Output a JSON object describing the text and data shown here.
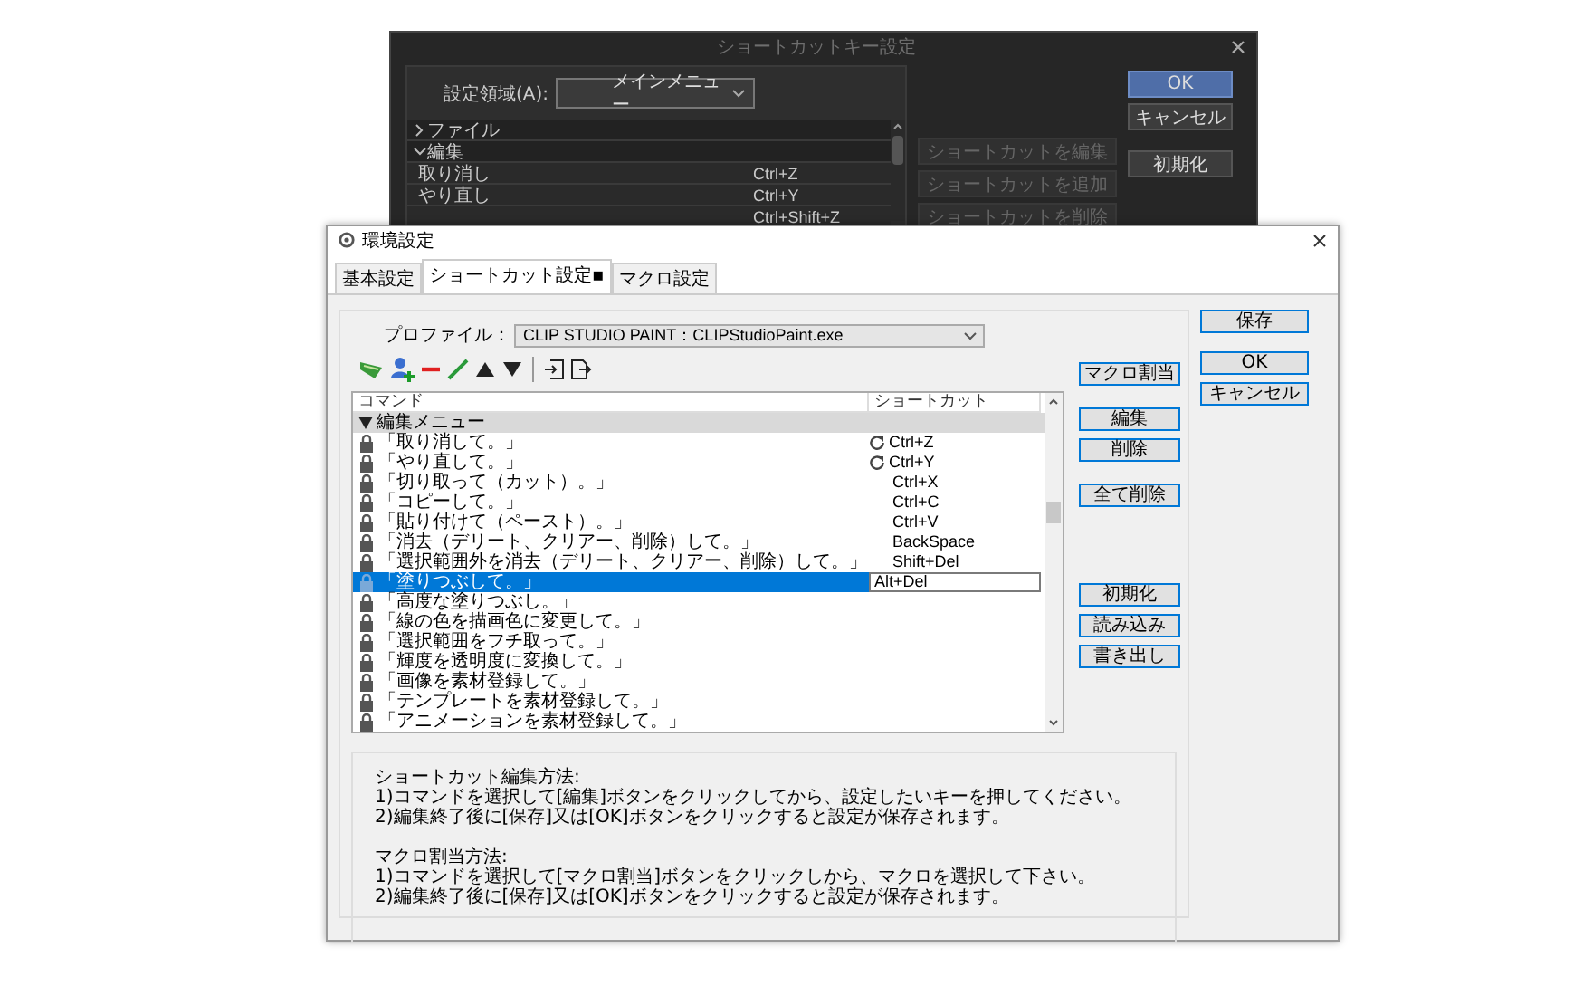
{
  "back_dialog": {
    "title": "ショートカットキー設定",
    "area_label": "設定領域(A):",
    "area_value": "メインメニュー",
    "tree": [
      {
        "kind": "group",
        "label": "ファイル",
        "expanded": false
      },
      {
        "kind": "group",
        "label": "編集",
        "expanded": true
      },
      {
        "kind": "item",
        "label": "取り消し",
        "shortcut": "Ctrl+Z"
      },
      {
        "kind": "item",
        "label": "やり直し",
        "shortcut": "Ctrl+Y"
      },
      {
        "kind": "item",
        "shortcut": "Ctrl+Shift+Z"
      }
    ],
    "side_buttons": [
      {
        "label": "ショートカットを編集",
        "disabled": true
      },
      {
        "label": "ショートカットを追加",
        "disabled": true
      },
      {
        "label": "ショートカットを削除",
        "disabled": true
      }
    ],
    "buttons": [
      {
        "label": "OK",
        "default": true
      },
      {
        "label": "キャンセル",
        "default": false
      },
      {
        "label": "初期化",
        "default": false
      }
    ]
  },
  "window": {
    "title": "環境設定",
    "tabs": [
      {
        "label": "基本設定",
        "selected": false
      },
      {
        "label": "ショートカット設定▪",
        "selected": true
      },
      {
        "label": "マクロ設定",
        "selected": false
      }
    ],
    "profile": {
      "label": "プロファイル：",
      "value": "CLIP STUDIO PAINT：CLIPStudioPaint.exe"
    },
    "table": {
      "columns": [
        "コマンド",
        "ショートカット"
      ],
      "group": {
        "label": "編集メニュー",
        "expanded": true
      },
      "rows": [
        {
          "command": "「取り消して。」",
          "shortcut": "Ctrl+Z",
          "modified": true,
          "selected": false
        },
        {
          "command": "「やり直して。」",
          "shortcut": "Ctrl+Y",
          "modified": true,
          "selected": false
        },
        {
          "command": "「切り取って（カット）。」",
          "shortcut": "Ctrl+X",
          "modified": false,
          "selected": false
        },
        {
          "command": "「コピーして。」",
          "shortcut": "Ctrl+C",
          "modified": false,
          "selected": false
        },
        {
          "command": "「貼り付けて（ペースト）。」",
          "shortcut": "Ctrl+V",
          "modified": false,
          "selected": false
        },
        {
          "command": "「消去（デリート、クリアー、削除）して。」",
          "shortcut": "BackSpace",
          "modified": false,
          "selected": false
        },
        {
          "command": "「選択範囲外を消去（デリート、クリアー、削除）して。」",
          "shortcut": "Shift+Del",
          "modified": false,
          "selected": false
        },
        {
          "command": "「塗りつぶして。」",
          "shortcut": "Alt+Del",
          "modified": false,
          "selected": true
        },
        {
          "command": "「高度な塗りつぶし。」",
          "modified": false,
          "selected": false
        },
        {
          "command": "「線の色を描画色に変更して。」",
          "modified": false,
          "selected": false
        },
        {
          "command": "「選択範囲をフチ取って。」",
          "modified": false,
          "selected": false
        },
        {
          "command": "「輝度を透明度に変換して。」",
          "modified": false,
          "selected": false
        },
        {
          "command": "「画像を素材登録して。」",
          "modified": false,
          "selected": false
        },
        {
          "command": "「テンプレートを素材登録して。」",
          "modified": false,
          "selected": false
        },
        {
          "command": "「アニメーションを素材登録して。」",
          "modified": false,
          "selected": false
        }
      ]
    },
    "mid_buttons": [
      [
        "マクロ割当"
      ],
      [
        "編集",
        "削除"
      ],
      [
        "全て削除"
      ],
      [
        "初期化",
        "読み込み",
        "書き出し"
      ]
    ],
    "side_buttons": [
      [
        "保存"
      ],
      [
        "OK",
        "キャンセル"
      ]
    ],
    "info": [
      {
        "heading": "ショートカット編集方法:",
        "lines": [
          "1)コマンドを選択して[編集]ボタンをクリックしてから、設定したいキーを押してください。",
          "2)編集終了後に[保存]又は[OK]ボタンをクリックすると設定が保存されます。"
        ]
      },
      {
        "heading": "マクロ割当方法:",
        "lines": [
          "1)コマンドを選択して[マクロ割当]ボタンをクリックしから、マクロを選択して下さい。",
          "2)編集終了後に[保存]又は[OK]ボタンをクリックすると設定が保存されます。"
        ]
      }
    ]
  }
}
